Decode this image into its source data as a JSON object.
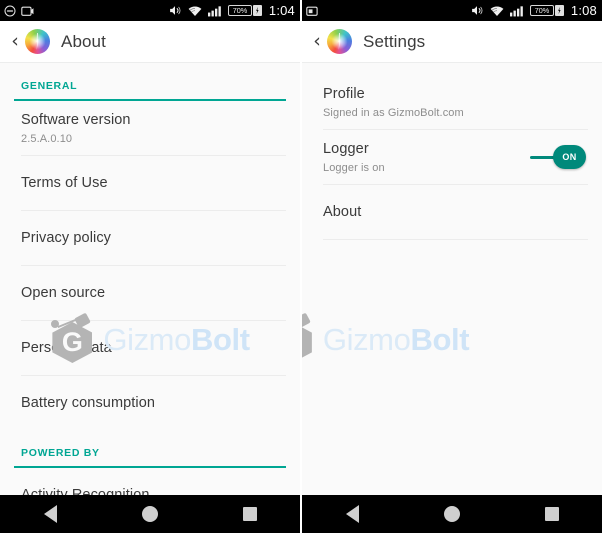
{
  "theme": {
    "accent_teal": "#00a693",
    "toggle_green": "#00897b",
    "text_primary": "#3a3a3a",
    "text_secondary": "#8d8d8d",
    "bg": "#fafafa",
    "statusbar_bg": "#000000",
    "navbar_bg": "#000000"
  },
  "watermark": {
    "logo_glyph": "G",
    "text_light": "Gizmo",
    "text_bold": "Bolt",
    "color_light": "#dbeaf7",
    "color_bold": "#cfe4f7",
    "logo_color": "#b4b4b4"
  },
  "navbar": {
    "back_label": "Back",
    "home_label": "Home",
    "recents_label": "Recents"
  },
  "left_screen": {
    "statusbar": {
      "notification_icons": [
        "do-not-disturb-icon",
        "screenshot-icon"
      ],
      "volume_icon": "volume-icon",
      "wifi_icon": "wifi-icon",
      "signal_icon": "signal-icon",
      "battery_percent": "70%",
      "battery_charging": true,
      "time": "1:04"
    },
    "appbar": {
      "back_icon": "back-chevron-icon",
      "app_icon": "app-logo-icon",
      "title": "About"
    },
    "sections": [
      {
        "header": "GENERAL",
        "rows": [
          {
            "title": "Software version",
            "sub": "2.5.A.0.10"
          },
          {
            "title": "Terms of Use",
            "sub": ""
          },
          {
            "title": "Privacy policy",
            "sub": ""
          },
          {
            "title": "Open source",
            "sub": ""
          },
          {
            "title": "Personal data",
            "sub": ""
          },
          {
            "title": "Battery consumption",
            "sub": ""
          }
        ]
      },
      {
        "header": "POWERED BY",
        "rows": [
          {
            "title": "Activity Recognition",
            "sub": ""
          }
        ]
      }
    ]
  },
  "right_screen": {
    "statusbar": {
      "notification_icons": [
        "screenshot-icon"
      ],
      "volume_icon": "volume-icon",
      "wifi_icon": "wifi-icon",
      "signal_icon": "signal-icon",
      "battery_percent": "70%",
      "battery_charging": true,
      "time": "1:08"
    },
    "appbar": {
      "back_icon": "back-chevron-icon",
      "app_icon": "app-logo-icon",
      "title": "Settings"
    },
    "rows": [
      {
        "title": "Profile",
        "sub": "Signed in as GizmoBolt.com",
        "toggle": null
      },
      {
        "title": "Logger",
        "sub": "Logger is on",
        "toggle": "ON"
      },
      {
        "title": "About",
        "sub": "",
        "toggle": null
      }
    ]
  }
}
